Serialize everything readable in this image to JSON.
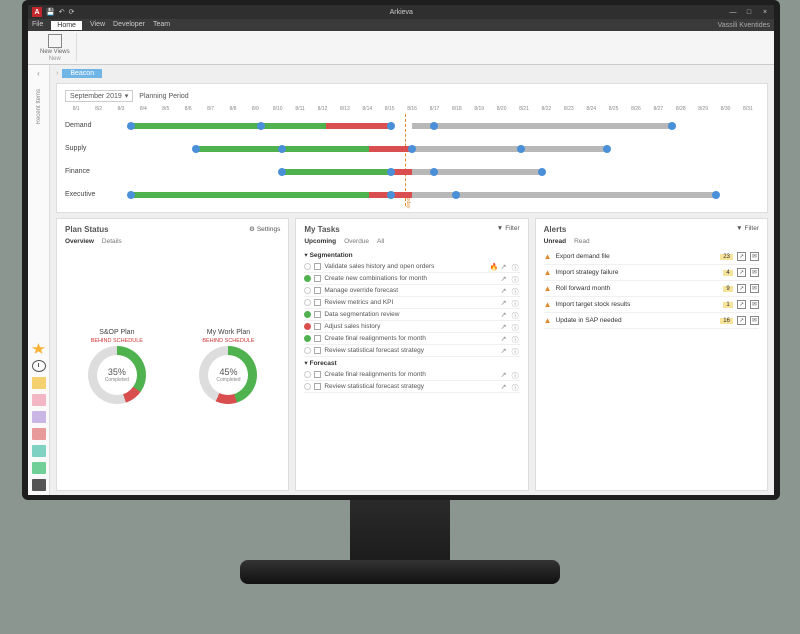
{
  "app": {
    "title": "Arkieva",
    "user": "Vassili Kventides"
  },
  "menubar": {
    "file": "File",
    "home": "Home",
    "view": "View",
    "developer": "Developer",
    "team": "Team"
  },
  "ribbon": {
    "new_views": "New Views",
    "group_new": "New"
  },
  "sidebar": {
    "recent": "Recent Items",
    "folders": [
      {
        "name": "yellow",
        "color": "#f4d06f"
      },
      {
        "name": "pink",
        "color": "#f2b6c4"
      },
      {
        "name": "purple",
        "color": "#c9b6e4"
      },
      {
        "name": "red",
        "color": "#e89a9a"
      },
      {
        "name": "teal",
        "color": "#7fd1c1"
      },
      {
        "name": "green",
        "color": "#6fcf97"
      },
      {
        "name": "dark",
        "color": "#555"
      }
    ]
  },
  "crumb": {
    "tag": "Beacon"
  },
  "timeline": {
    "period_label": "Planning Period",
    "period_value": "September 2019",
    "ticks": [
      "8/1",
      "8/2",
      "8/3",
      "8/4",
      "8/5",
      "8/6",
      "8/7",
      "8/8",
      "8/9",
      "8/10",
      "8/11",
      "8/12",
      "8/13",
      "8/14",
      "8/15",
      "8/16",
      "8/17",
      "8/18",
      "8/19",
      "8/20",
      "8/21",
      "8/22",
      "8/23",
      "8/24",
      "8/25",
      "8/26",
      "8/27",
      "8/28",
      "8/29",
      "8/30",
      "8/31"
    ],
    "rows": [
      "Demand",
      "Supply",
      "Finance",
      "Executive"
    ],
    "today": "Today"
  },
  "chart_data": {
    "type": "gantt",
    "title": "Planning Period",
    "period": "September 2019",
    "x_axis": {
      "unit": "day",
      "min": 1,
      "max": 31,
      "today": 15
    },
    "rows": [
      {
        "name": "Demand",
        "segments": [
          {
            "start": 2,
            "end": 11,
            "status": "green"
          },
          {
            "start": 11,
            "end": 14,
            "status": "red"
          },
          {
            "start": 15,
            "end": 27,
            "status": "grey"
          }
        ],
        "milestones": [
          2,
          8,
          14,
          16,
          27
        ]
      },
      {
        "name": "Supply",
        "segments": [
          {
            "start": 5,
            "end": 13,
            "status": "green"
          },
          {
            "start": 13,
            "end": 15,
            "status": "red"
          },
          {
            "start": 15,
            "end": 24,
            "status": "grey"
          }
        ],
        "milestones": [
          5,
          9,
          15,
          20,
          24
        ]
      },
      {
        "name": "Finance",
        "segments": [
          {
            "start": 9,
            "end": 14,
            "status": "green"
          },
          {
            "start": 14,
            "end": 15,
            "status": "red"
          },
          {
            "start": 15,
            "end": 21,
            "status": "grey"
          }
        ],
        "milestones": [
          9,
          14,
          16,
          21
        ]
      },
      {
        "name": "Executive",
        "segments": [
          {
            "start": 2,
            "end": 13,
            "status": "green"
          },
          {
            "start": 13,
            "end": 15,
            "status": "red"
          },
          {
            "start": 15,
            "end": 29,
            "status": "grey"
          }
        ],
        "milestones": [
          2,
          14,
          17,
          29
        ]
      }
    ]
  },
  "plan_status": {
    "title": "Plan Status",
    "tabs": {
      "overview": "Overview",
      "details": "Details"
    },
    "settings": "Settings",
    "plans": [
      {
        "title": "S&OP Plan",
        "status": "BEHIND SCHEDULE",
        "pct": "35%",
        "completed": "Completed",
        "green": 35,
        "red": 10
      },
      {
        "title": "My Work Plan",
        "status": "BEHIND SCHEDULE",
        "pct": "45%",
        "completed": "Completed",
        "green": 45,
        "red": 12
      }
    ]
  },
  "my_tasks": {
    "title": "My Tasks",
    "tabs": {
      "upcoming": "Upcoming",
      "overdue": "Overdue",
      "all": "All"
    },
    "filter": "Filter",
    "groups": [
      {
        "name": "Segmentation",
        "tasks": [
          {
            "stat": "none",
            "text": "Validate sales history and open orders",
            "hot": true
          },
          {
            "stat": "grn",
            "text": "Create new combinations for month"
          },
          {
            "stat": "none",
            "text": "Manage override forecast"
          },
          {
            "stat": "none",
            "text": "Review metrics and KPI"
          },
          {
            "stat": "grn",
            "text": "Data segmentation review"
          },
          {
            "stat": "red",
            "text": "Adjust sales history"
          },
          {
            "stat": "grn",
            "text": "Create final realignments for month"
          },
          {
            "stat": "none",
            "text": "Review statistical forecast strategy"
          }
        ]
      },
      {
        "name": "Forecast",
        "tasks": [
          {
            "stat": "none",
            "text": "Create final realignments for month"
          },
          {
            "stat": "none",
            "text": "Review statistical forecast strategy"
          }
        ]
      }
    ]
  },
  "alerts": {
    "title": "Alerts",
    "tabs": {
      "unread": "Unread",
      "read": "Read"
    },
    "filter": "Filter",
    "items": [
      {
        "text": "Export demand file",
        "count": "23"
      },
      {
        "text": "Import strategy failure",
        "count": "4"
      },
      {
        "text": "Roll forward month",
        "count": "9"
      },
      {
        "text": "Import target stock results",
        "count": "1"
      },
      {
        "text": "Update in SAP needed",
        "count": "16"
      }
    ]
  }
}
